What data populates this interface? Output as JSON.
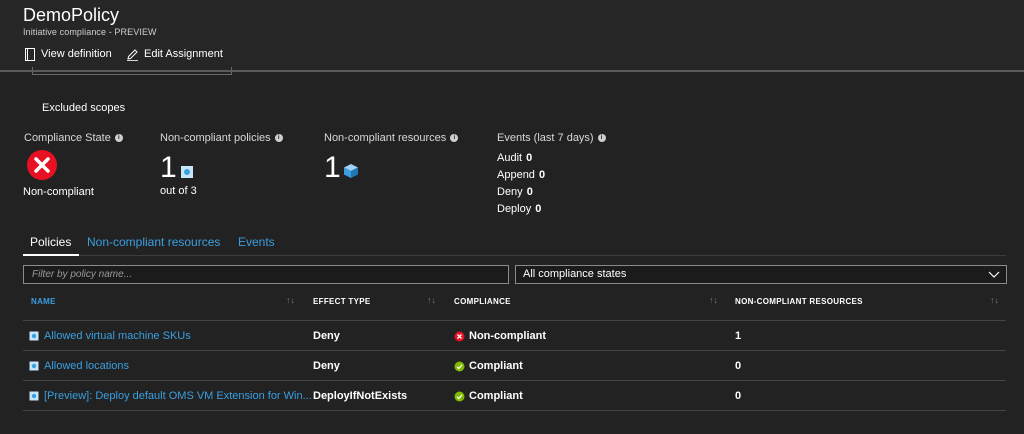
{
  "header": {
    "title": "DemoPolicy",
    "subtitle": "Initiative compliance - PREVIEW",
    "view_definition_label": "View definition",
    "edit_assignment_label": "Edit Assignment"
  },
  "excluded_scopes_label": "Excluded scopes",
  "stats": {
    "compliance_state_label": "Compliance State",
    "compliance_state_value": "Non-compliant",
    "noncompliant_policies_label": "Non-compliant policies",
    "noncompliant_policies_count": "1",
    "noncompliant_policies_total": "out of 3",
    "noncompliant_resources_label": "Non-compliant resources",
    "noncompliant_resources_count": "1",
    "events_label": "Events (last 7 days)",
    "events": [
      {
        "name": "Audit",
        "count": "0"
      },
      {
        "name": "Append",
        "count": "0"
      },
      {
        "name": "Deny",
        "count": "0"
      },
      {
        "name": "Deploy",
        "count": "0"
      }
    ]
  },
  "tabs": [
    {
      "label": "Policies",
      "active": true
    },
    {
      "label": "Non-compliant resources",
      "active": false
    },
    {
      "label": "Events",
      "active": false
    }
  ],
  "filter": {
    "placeholder": "Filter by policy name...",
    "value": "",
    "state_select_value": "All compliance states"
  },
  "table": {
    "columns": [
      "NAME",
      "EFFECT TYPE",
      "COMPLIANCE",
      "NON-COMPLIANT RESOURCES"
    ],
    "rows": [
      {
        "name": "Allowed virtual machine SKUs",
        "effect": "Deny",
        "compliance": "Non-compliant",
        "noncompliant_resources": "1"
      },
      {
        "name": "Allowed locations",
        "effect": "Deny",
        "compliance": "Compliant",
        "noncompliant_resources": "0"
      },
      {
        "name": "[Preview]: Deploy default OMS VM Extension for Win...",
        "effect": "DeployIfNotExists",
        "compliance": "Compliant",
        "noncompliant_resources": "0"
      }
    ]
  },
  "colors": {
    "accent": "#3a9fe0",
    "error": "#e81123",
    "success": "#7fba00"
  }
}
